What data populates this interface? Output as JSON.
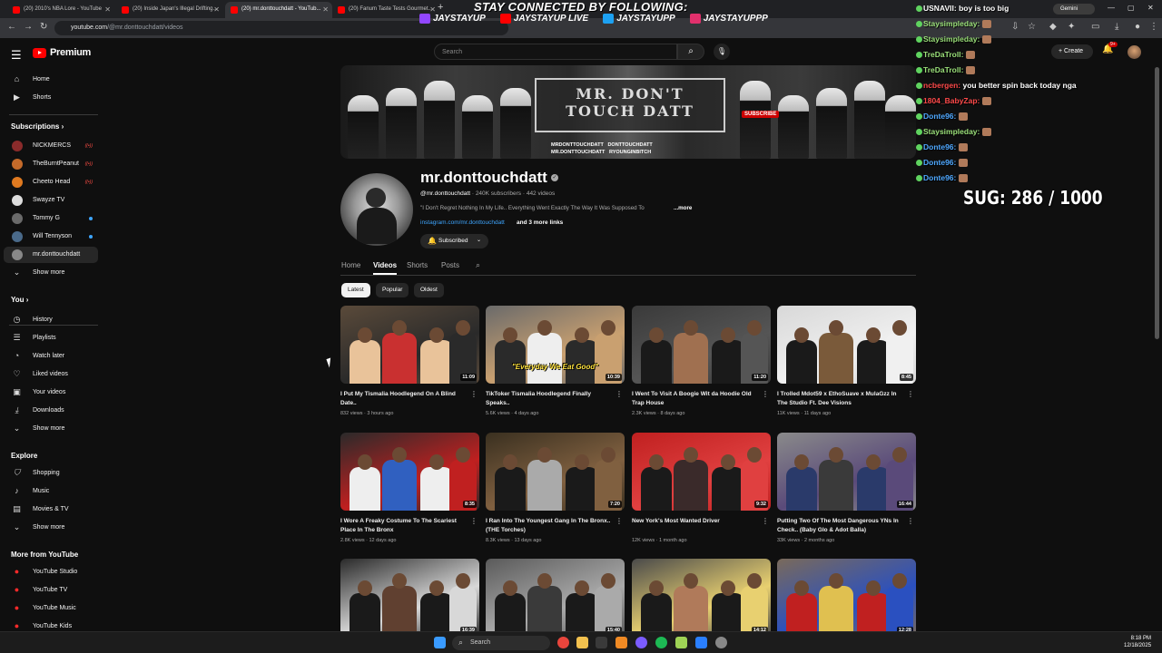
{
  "browser": {
    "tabs": [
      {
        "title": "(20) 2010's NBA Lore - YouTube",
        "active": false
      },
      {
        "title": "(20) Inside Japan's Illegal Drifting...",
        "active": false
      },
      {
        "title": "(20) mr.donttouchdatt - YouTub...",
        "active": true
      },
      {
        "title": "(20) Fanum Taste Tests Gourmet...",
        "active": false
      }
    ],
    "url_host": "youtube.com",
    "url_path": "/@mr.donttouchdatt/videos",
    "gemini_label": "Gemini"
  },
  "overlay": {
    "title": "STAY CONNECTED BY FOLLOWING:",
    "socials": [
      {
        "icon": "twitch-icon",
        "handle": "JAYSTAYUP",
        "color": "#9146ff"
      },
      {
        "icon": "youtube-icon",
        "handle": "JAYSTAYUP LIVE",
        "color": "#ff0000"
      },
      {
        "icon": "twitter-icon",
        "handle": "JAYSTAYUPP",
        "color": "#1da1f2"
      },
      {
        "icon": "instagram-icon",
        "handle": "JAYSTAYUPPP",
        "color": "#e1306c"
      }
    ],
    "sug_counter": "SUG:  286 / 1000"
  },
  "chat": [
    {
      "user": "USNAVII:",
      "text": "boy is too big",
      "color": "#ffffff"
    },
    {
      "user": "Staysimpleday:",
      "text": "",
      "color": "#9be07a"
    },
    {
      "user": "Staysimpleday:",
      "text": "",
      "color": "#9be07a"
    },
    {
      "user": "TreDaTroll:",
      "text": "",
      "color": "#9be07a"
    },
    {
      "user": "TreDaTroll:",
      "text": "",
      "color": "#9be07a"
    },
    {
      "user": "ncbergen:",
      "text": "you better spin back today nga",
      "color": "#ff4a4a"
    },
    {
      "user": "1804_BabyZap:",
      "text": "",
      "color": "#ff4a4a"
    },
    {
      "user": "Donte96:",
      "text": "",
      "color": "#4fa8ff"
    },
    {
      "user": "Staysimpleday:",
      "text": "",
      "color": "#9be07a"
    },
    {
      "user": "Donte96:",
      "text": "",
      "color": "#4fa8ff"
    },
    {
      "user": "Donte96:",
      "text": "",
      "color": "#4fa8ff"
    },
    {
      "user": "Donte96:",
      "text": "",
      "color": "#4fa8ff"
    }
  ],
  "youtube": {
    "logo": "Premium",
    "search_placeholder": "Search",
    "create_label": "Create",
    "notif_count": "9+"
  },
  "sidebar": {
    "main": [
      {
        "label": "Home",
        "icon": "home-icon",
        "glyph": "⌂"
      },
      {
        "label": "Shorts",
        "icon": "shorts-icon",
        "glyph": "▶"
      }
    ],
    "subscriptions_header": "Subscriptions",
    "subscriptions": [
      {
        "label": "NICKMERCS",
        "color": "#8a2b2b",
        "status": "live"
      },
      {
        "label": "TheBurntPeanut",
        "color": "#c46a2a",
        "status": "live"
      },
      {
        "label": "Cheeto Head",
        "color": "#e07a20",
        "status": "live"
      },
      {
        "label": "Swayze TV",
        "color": "#dddddd",
        "status": ""
      },
      {
        "label": "Tommy G",
        "color": "#6a6a6a",
        "status": "new"
      },
      {
        "label": "Will Tennyson",
        "color": "#4a6a8a",
        "status": "new"
      },
      {
        "label": "mr.donttouchdatt",
        "color": "#888888",
        "status": ""
      }
    ],
    "show_more": "Show more",
    "you_header": "You",
    "you": [
      {
        "label": "History",
        "icon": "history-icon",
        "glyph": "◷"
      },
      {
        "label": "Playlists",
        "icon": "playlists-icon",
        "glyph": "☰"
      },
      {
        "label": "Watch later",
        "icon": "watch-later-icon",
        "glyph": "◔"
      },
      {
        "label": "Liked videos",
        "icon": "like-icon",
        "glyph": "♡"
      },
      {
        "label": "Your videos",
        "icon": "your-videos-icon",
        "glyph": "▣"
      },
      {
        "label": "Downloads",
        "icon": "download-icon",
        "glyph": "⤓"
      },
      {
        "label": "Show more",
        "icon": "chevron-down-icon",
        "glyph": "⌄"
      }
    ],
    "explore_header": "Explore",
    "explore": [
      {
        "label": "Shopping",
        "icon": "shopping-icon",
        "glyph": "⛉"
      },
      {
        "label": "Music",
        "icon": "music-icon",
        "glyph": "♪"
      },
      {
        "label": "Movies & TV",
        "icon": "movies-icon",
        "glyph": "▤"
      },
      {
        "label": "Show more",
        "icon": "chevron-down-icon",
        "glyph": "⌄"
      }
    ],
    "more_header": "More from YouTube",
    "more": [
      {
        "label": "YouTube Studio"
      },
      {
        "label": "YouTube TV"
      },
      {
        "label": "YouTube Music"
      },
      {
        "label": "YouTube Kids"
      }
    ]
  },
  "channel": {
    "name": "mr.donttouchdatt",
    "handle": "@mr.donttouchdatt",
    "subscribers": "240K subscribers",
    "videos_count": "442 videos",
    "description": "\"I Don't Regret Nothing In My Life.. Everything Went Exactly The Way It Was Supposed To",
    "more": "...more",
    "link": "instagram.com/mr.donttouchdatt",
    "links_more": "and 3 more links",
    "subscribed_label": "Subscribed",
    "banner_line1": "MR. DON'T",
    "banner_line2": "TOUCH DATT",
    "banner_handles": [
      "MRDONTTOUCHDATT",
      "DONTTOUCHDATT",
      "MR.DONTTOUCHDATT",
      "RYOUNGINBITCH"
    ],
    "banner_subscribe": "SUBSCRIBE",
    "tabs": [
      "Home",
      "Videos",
      "Shorts",
      "Posts"
    ],
    "chips": [
      "Latest",
      "Popular",
      "Oldest"
    ]
  },
  "videos": [
    {
      "title": "I Put My Tismalia Hoodlegend On A Blind Date..",
      "views": "832 views",
      "age": "3 hours ago",
      "duration": "11:09"
    },
    {
      "title": "TikToker Tismalia Hoodlegend Finally Speaks..",
      "views": "5.6K views",
      "age": "4 days ago",
      "duration": "10:39",
      "caption": "\"Everyday We Eat Good\""
    },
    {
      "title": "I Went To Visit A Boogie Wit da Hoodie Old Trap House",
      "views": "2.3K views",
      "age": "8 days ago",
      "duration": "11:20"
    },
    {
      "title": "I Trolled Mdot59 x EthoSuave x MulaGzz In The Studio Ft. Dee Visions",
      "views": "11K views",
      "age": "11 days ago",
      "duration": "8:45"
    },
    {
      "title": "I Wore A Freaky Costume To The Scariest Place In The Bronx",
      "views": "2.8K views",
      "age": "12 days ago",
      "duration": "8:35"
    },
    {
      "title": "I Ran Into The Youngest Gang In The Bronx.. (THE Torches)",
      "views": "8.3K views",
      "age": "13 days ago",
      "duration": "7:20"
    },
    {
      "title": "New York's Most Wanted Driver",
      "views": "12K views",
      "age": "1 month ago",
      "duration": "9:32"
    },
    {
      "title": "Putting Two Of The Most Dangerous YNs In Check.. (Baby Glo & Adot Balla)",
      "views": "33K views",
      "age": "2 months ago",
      "duration": "16:44"
    },
    {
      "title": "",
      "views": "",
      "age": "",
      "duration": "16:39"
    },
    {
      "title": "",
      "views": "",
      "age": "",
      "duration": "15:40"
    },
    {
      "title": "",
      "views": "",
      "age": "",
      "duration": "14:12"
    },
    {
      "title": "",
      "views": "",
      "age": "",
      "duration": "12:28"
    }
  ],
  "taskbar": {
    "search": "Search",
    "time": "8:18 PM",
    "date": "12/18/2025"
  }
}
